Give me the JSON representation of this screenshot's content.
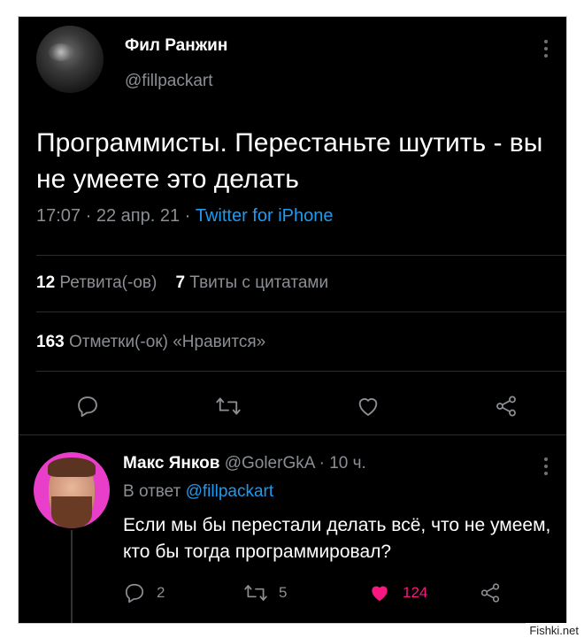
{
  "tweet": {
    "author_name": "Фил Ранжин",
    "author_handle": "@fillpackart",
    "text": "Программисты. Перестаньте шутить - вы не умеете это делать",
    "time": "17:07 · 22 апр. 21 · ",
    "source": "Twitter for iPhone",
    "retweets_count": "12",
    "retweets_label": "Ретвита(-ов)",
    "quotes_count": "7",
    "quotes_label": "Твиты с цитатами",
    "likes_count": "163",
    "likes_label": "Отметки(-ок) «Нравится»",
    "more_icon": "vertical-dots-icon"
  },
  "actions": {
    "reply_icon": "reply-icon",
    "retweet_icon": "retweet-icon",
    "like_icon": "heart-icon",
    "share_icon": "share-icon"
  },
  "reply": {
    "author_name": "Макс Янков",
    "author_handle_time": "@GolerGkA · 10 ч.",
    "replying_prefix": "В ответ",
    "replying_to": "@fillpackart",
    "text": "Если мы бы перестали делать всё, что не умеем, кто бы тогда программировал?",
    "reply_count": "2",
    "retweet_count": "5",
    "like_count": "124"
  },
  "colors": {
    "background": "#000000",
    "link": "#1d9bf0",
    "secondary_text": "#8b8f94",
    "like_red": "#f91880"
  },
  "watermark": "Fishki.net"
}
